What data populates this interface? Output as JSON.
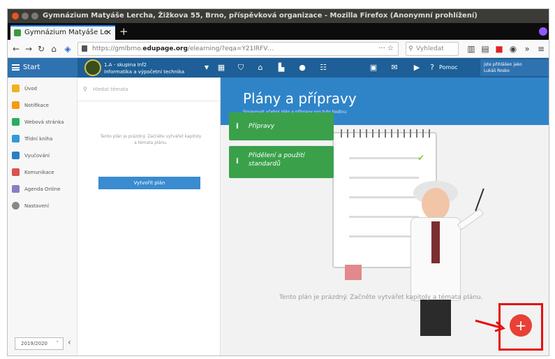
{
  "window": {
    "title": "Gymnázium Matyáše Lercha, Žižkova 55, Brno, příspěvková organizace - Mozilla Firefox (Anonymní prohlížení)"
  },
  "tab": {
    "label": "Gymnázium Matyáše Le",
    "close": "✕",
    "new_tab": "+"
  },
  "navbar": {
    "url_prefix": "https://gmlbrno.",
    "url_domain": "edupage.org",
    "url_rest": "/elearning/?eqa=Y21lRFV…",
    "url_tail": "··· ☆",
    "search_placeholder": "Vyhledat"
  },
  "app": {
    "start_label": "Start",
    "class_name": "1.A - skupina Inf2",
    "class_subject": "Informatika a výpočetní technika",
    "help_label": "Pomoc",
    "user_line1": "jste přihlášen jako",
    "user_line2": "Lukáš Rosko"
  },
  "sidebar": {
    "items": [
      {
        "label": "Úvod",
        "color": "#f2b01e"
      },
      {
        "label": "Notifikace",
        "color": "#f39c12"
      },
      {
        "label": "Webová stránka",
        "color": "#27ae60"
      },
      {
        "label": "Třídní kniha",
        "color": "#3498db"
      },
      {
        "label": "Vyučování",
        "color": "#2c7fc1"
      },
      {
        "label": "Komunikace",
        "color": "#d9534f"
      },
      {
        "label": "Agenda Online",
        "color": "#8e7cc3"
      },
      {
        "label": "Nastavení",
        "color": "#888888"
      }
    ],
    "school_year": "2019/2020",
    "collapse": "‹"
  },
  "plans": {
    "search_placeholder": "Hledat témata",
    "empty_text": "Tento plán je prázdný. Začněte vytvářet kapitoly a témata plánu.",
    "create_button": "Vytvořit plán"
  },
  "main": {
    "title": "Plány a přípravy",
    "subtitle": "Spravovat učební plán a přípravy pro tuto hodinu",
    "empty_text": "Tento plán je prázdný. Začněte vytvářet kapitoly a témata plánu."
  },
  "tips": [
    {
      "icon": "i",
      "label": "Přípravy"
    },
    {
      "icon": "i",
      "label": "Přidělení a použití standardů"
    }
  ],
  "fab": {
    "label": "+"
  },
  "colors": {
    "header": "#1d5f96",
    "hero": "#2f84c8",
    "tip": "#3aa14a",
    "fab": "#e84035",
    "highlight": "#e51010"
  }
}
